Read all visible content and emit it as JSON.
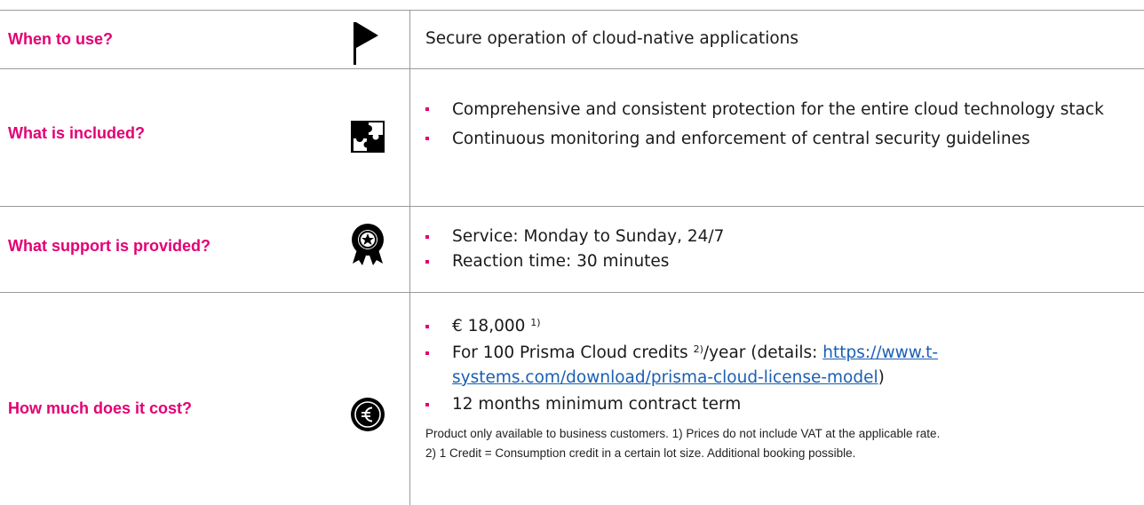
{
  "rows": {
    "when": {
      "label": "When to use?",
      "icon": "flag-icon",
      "text": "Secure operation of cloud-native applications"
    },
    "included": {
      "label": "What is included?",
      "icon": "puzzle-icon",
      "items": [
        "Comprehensive and consistent protection for the entire cloud technology stack",
        "Continuous monitoring and enforcement of central security guidelines"
      ]
    },
    "support": {
      "label": "What support is provided?",
      "icon": "award-badge-icon",
      "items": [
        "Service: Monday to Sunday, 24/7",
        "Reaction time: 30 minutes"
      ]
    },
    "cost": {
      "label": "How much does it cost?",
      "icon": "euro-icon",
      "price": "€ 18,000",
      "price_note": "1)",
      "credits_prefix": "For 100 Prisma Cloud credits",
      "credits_note": "2)",
      "credits_mid": "/year (details: ",
      "link": "https://www.t-systems.com/download/prisma-cloud-license-model",
      "credits_suffix": ")",
      "term": "12 months minimum contract term",
      "footnote1": "Product only available to business customers. 1) Prices do not include VAT at the applicable rate.",
      "footnote2": "2) 1 Credit = Consumption credit in a certain lot size. Additional booking possible."
    }
  },
  "colors": {
    "accent": "#e20074",
    "link": "#1a5fb4",
    "rule": "#9a9a9a"
  }
}
